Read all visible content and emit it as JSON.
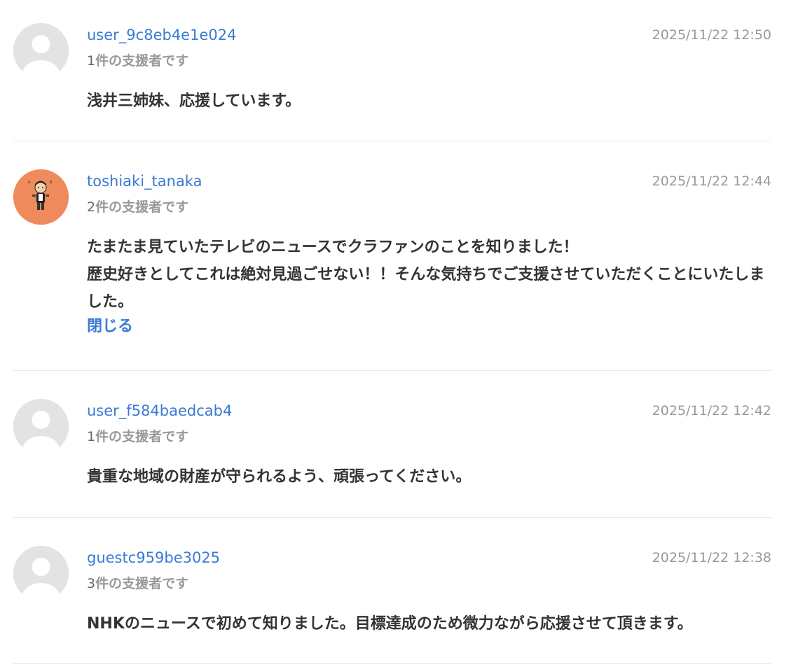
{
  "comments": [
    {
      "username": "user_9c8eb4e1e024",
      "date": "2025/11/22 12:50",
      "support_count_num": "1",
      "support_count_suffix": "件の支援者です",
      "message": "浅井三姉妹、応援しています。",
      "avatar": "default-avatar-icon"
    },
    {
      "username": "toshiaki_tanaka",
      "date": "2025/11/22 12:44",
      "support_count_num": "2",
      "support_count_suffix": "件の支援者です",
      "message": "たまたま見ていたテレビのニュースでクラファンのことを知りました！\n歴史好きとしてこれは絶対見過ごせない！！そんな気持ちでご支援させていただくことにいたしました。",
      "toggle_label": "閉じる",
      "avatar": "user-photo-avatar",
      "avatar_color": "#ef8a5d"
    },
    {
      "username": "user_f584baedcab4",
      "date": "2025/11/22 12:42",
      "support_count_num": "1",
      "support_count_suffix": "件の支援者です",
      "message": "貴重な地域の財産が守られるよう、頑張ってください。",
      "avatar": "default-avatar-icon"
    },
    {
      "username": "guestc959be3025",
      "date": "2025/11/22 12:38",
      "support_count_num": "3",
      "support_count_suffix": "件の支援者です",
      "message": "NHKのニュースで初めて知りました。目標達成のため微力ながら応援させて頂きます。",
      "avatar": "default-avatar-icon"
    }
  ],
  "colors": {
    "link": "#3a7bd5",
    "muted": "#999999",
    "text": "#333333",
    "divider": "#e8e8e8",
    "avatar_bg": "#e3e3e3"
  }
}
